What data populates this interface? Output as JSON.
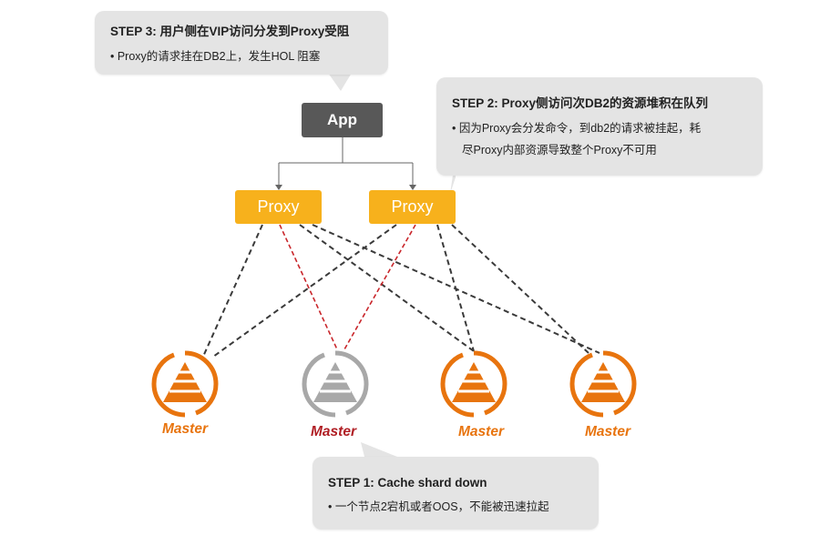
{
  "callouts": {
    "step3": {
      "title": "STEP 3:  用户侧在VIP访问分发到Proxy受阻",
      "bullet": "• Proxy的请求挂在DB2上，发生HOL 阻塞"
    },
    "step2": {
      "title": "STEP 2:  Proxy侧访问次DB2的资源堆积在队列",
      "bullet_line1": "• 因为Proxy会分发命令，到db2的请求被挂起，耗",
      "bullet_line2": "尽Proxy内部资源导致整个Proxy不可用"
    },
    "step1": {
      "title": "STEP 1:  Cache shard down",
      "bullet": "• 一个节点2宕机或者OOS，不能被迅速拉起"
    }
  },
  "nodes": {
    "app": "App",
    "proxy1": "Proxy",
    "proxy2": "Proxy",
    "masters": [
      {
        "label": "Master",
        "status": "up"
      },
      {
        "label": "Master",
        "status": "down"
      },
      {
        "label": "Master",
        "status": "up"
      },
      {
        "label": "Master",
        "status": "up"
      }
    ]
  },
  "colors": {
    "app": "#585858",
    "proxy": "#f7b11c",
    "master": "#e8740e",
    "master_down_label": "#b01e24",
    "master_down_icon": "#a8a8a8",
    "link": "#3a3a3a",
    "failed_link": "#c9262b",
    "callout_bg": "#e4e4e4"
  }
}
